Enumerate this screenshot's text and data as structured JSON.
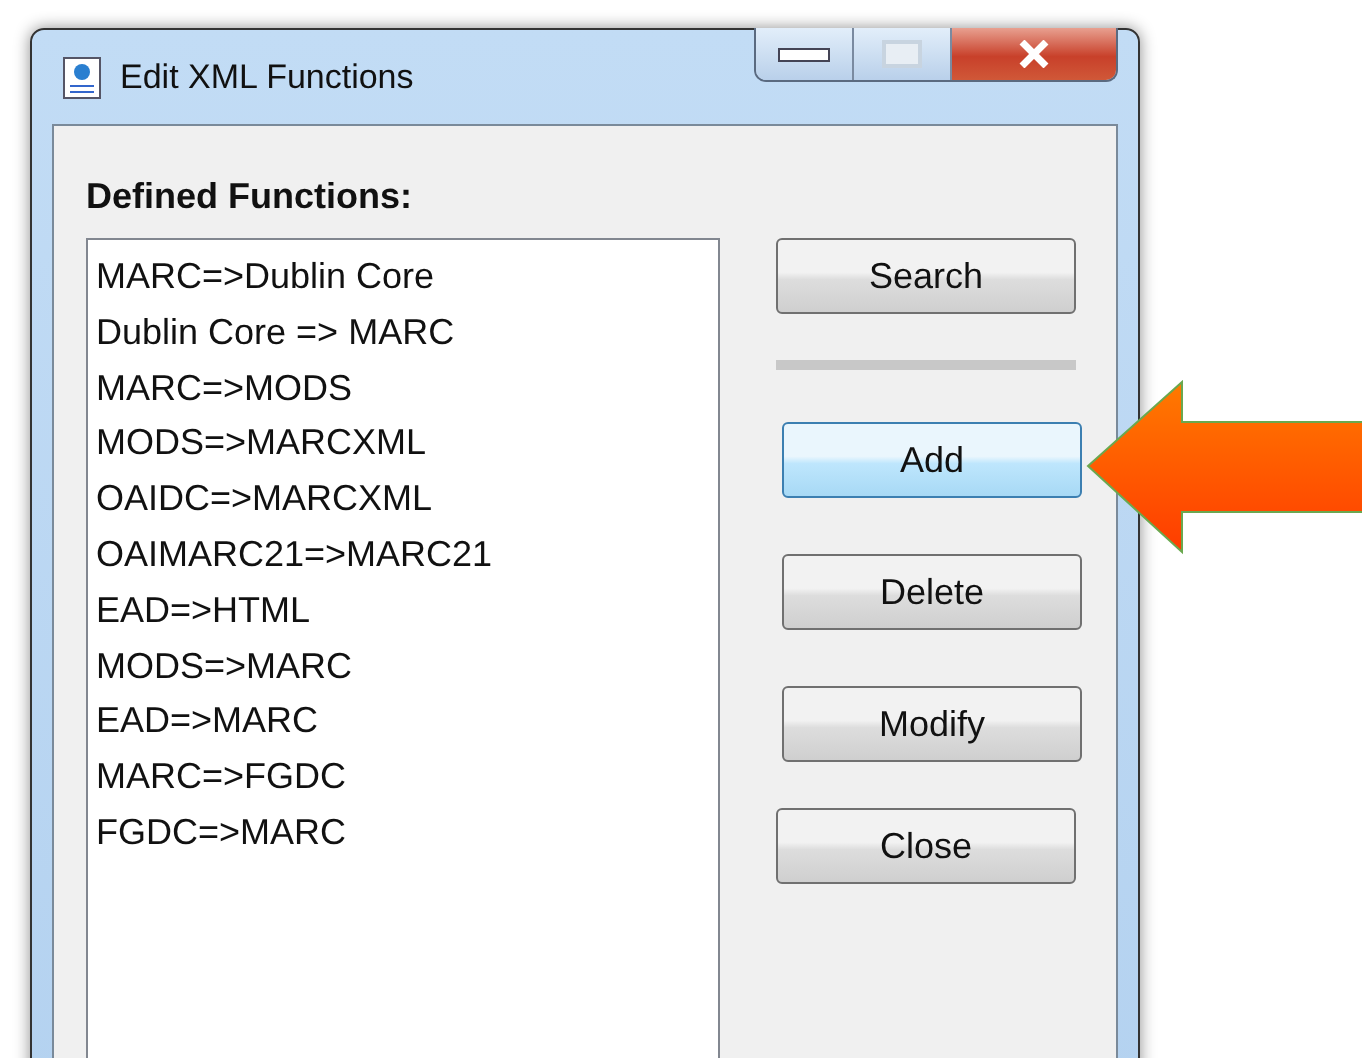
{
  "window": {
    "title": "Edit XML Functions"
  },
  "defined_functions": {
    "label": "Defined Functions:",
    "items": [
      {
        "label": "MARC=>Dublin Core"
      },
      {
        "label": "Dublin Core => MARC"
      },
      {
        "label": "MARC=>MODS"
      },
      {
        "label": "MODS=>MARCXML"
      },
      {
        "label": "OAIDC=>MARCXML"
      },
      {
        "label": "OAIMARC21=>MARC21"
      },
      {
        "label": "EAD=>HTML"
      },
      {
        "label": "MODS=>MARC"
      },
      {
        "label": "EAD=>MARC"
      },
      {
        "label": "MARC=>FGDC"
      },
      {
        "label": "FGDC=>MARC"
      }
    ]
  },
  "search_button": {
    "label": "Search"
  },
  "buttons": [
    {
      "label": "Add",
      "highlighted": true
    },
    {
      "label": "Delete",
      "highlighted": false
    },
    {
      "label": "Modify",
      "highlighted": false
    },
    {
      "label": "Close",
      "highlighted": false
    }
  ]
}
